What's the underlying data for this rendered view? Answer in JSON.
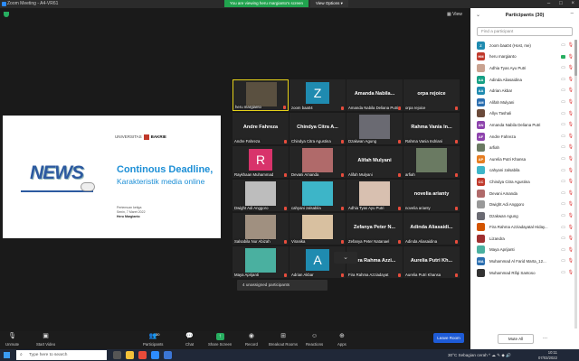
{
  "window": {
    "title": "Zoom Meeting - A4-VR61"
  },
  "viewbar": {
    "message": "You are viewing heru margianto's screen",
    "options_label": "View Options ▾"
  },
  "view_label": "▦ View",
  "slide": {
    "university": "UNIVERSITAS",
    "brand": "BAKRIE",
    "news": "NEWS",
    "title": "Continous Deadline,",
    "subtitle": "Karakteristik media online",
    "meta1": "Pertemuan ketiga",
    "meta2": "Senin, 7 Maret 2022",
    "meta3": "Heru Margianto"
  },
  "tiles": [
    {
      "name": "heru margianto",
      "kind": "photo",
      "color": "#5a5040",
      "active": true
    },
    {
      "name": "zoom baa04",
      "kind": "letter",
      "letter": "Z",
      "color": "#1f8bb0"
    },
    {
      "name": "Amanda Nabila Deliana Putri",
      "big": "Amanda Nabila...",
      "kind": "name"
    },
    {
      "name": "orpa rejoice",
      "big": "orpa rejoice",
      "kind": "name"
    },
    {
      "name": "Andre Fahreza",
      "big": "Andre Fahreza",
      "kind": "name"
    },
    {
      "name": "Chindya Citra Agustina",
      "big": "Chindya Citra A...",
      "kind": "name"
    },
    {
      "name": "Dzakwan Agung",
      "kind": "photo",
      "color": "#6a6a72"
    },
    {
      "name": "Rahma Vania Indriani",
      "big": "Rahma Vania In...",
      "kind": "name"
    },
    {
      "name": "Raykhaan Muhammad",
      "kind": "letter",
      "letter": "R",
      "color": "#d8336b"
    },
    {
      "name": "Devani Amanda",
      "kind": "photo",
      "color": "#b06a6a"
    },
    {
      "name": "Alifah Mulyani",
      "big": "Alifah Mulyani",
      "kind": "name"
    },
    {
      "name": "arfiah",
      "kind": "photo",
      "color": "#6a7a62"
    },
    {
      "name": "Dwight Adi Anggoro",
      "kind": "photo",
      "color": "#bdbdbd"
    },
    {
      "name": "cahyani zalsabila",
      "kind": "photo",
      "color": "#3db5c8"
    },
    {
      "name": "Adhia Tyas Ayu Putri",
      "kind": "photo",
      "color": "#d8c0b0"
    },
    {
      "name": "novelia arianty",
      "big": "novelia arianty",
      "kind": "name"
    },
    {
      "name": "Salsabila Nur Abizah",
      "kind": "photo",
      "color": "#a09080"
    },
    {
      "name": "Viranika",
      "kind": "photo",
      "color": "#d8c0a0"
    },
    {
      "name": "Zefanya Peter Natanael",
      "big": "Zefanya Peter N...",
      "kind": "name"
    },
    {
      "name": "Adinda Aliasaidina",
      "big": "Adinda Aliasaidi...",
      "kind": "name"
    },
    {
      "name": "Maya Aprijanti",
      "kind": "photo",
      "color": "#4ab0a0"
    },
    {
      "name": "Adrian Akbar",
      "kind": "letter",
      "letter": "A",
      "color": "#1f8bb0"
    },
    {
      "name": "Fira Rahma Azziadayat",
      "big": "Fira Rahma Azzi...",
      "kind": "name"
    },
    {
      "name": "Aurelia Putri Khansa",
      "big": "Aurelia Putri Kh...",
      "kind": "name"
    }
  ],
  "unassigned": "4 unassigned participants",
  "toolbar": {
    "unmute": "Unmute",
    "start_video": "Start Video",
    "participants": "Participants",
    "participants_count": "30",
    "chat": "Chat",
    "share": "Share Screen",
    "record": "Record",
    "breakout": "Breakout Rooms",
    "reactions": "Reactions",
    "apps": "Apps",
    "leave": "Leave Room"
  },
  "panel": {
    "title": "Participants (30)",
    "search_placeholder": "Find a participant",
    "mute_all": "Mute All",
    "more": "..."
  },
  "participants": [
    {
      "initials": "Z",
      "name": "zoom baa04 (Host, me)",
      "color": "#1f8bb0",
      "video": false
    },
    {
      "initials": "HM",
      "name": "heru margianto",
      "color": "#c0392b",
      "video": true
    },
    {
      "initials": "",
      "name": "Adhia Tyas Ayu Putri",
      "color": "#c9a290",
      "video": false
    },
    {
      "initials": "AA",
      "name": "Adinda Aliasaidina",
      "color": "#16a085",
      "video": false
    },
    {
      "initials": "AA",
      "name": "Adrian Akbar",
      "color": "#1f8bb0",
      "video": false
    },
    {
      "initials": "AM",
      "name": "Alifah Mulyani",
      "color": "#2c6fb0",
      "video": false
    },
    {
      "initials": "",
      "name": "Allyv Tashali",
      "color": "#6a4a3a",
      "video": false
    },
    {
      "initials": "AN",
      "name": "Amanda Nabila Deliana Putri",
      "color": "#8e44ad",
      "video": false
    },
    {
      "initials": "AF",
      "name": "Andre Fahreza",
      "color": "#8e44ad",
      "video": false
    },
    {
      "initials": "",
      "name": "arfiah",
      "color": "#6a7a62",
      "video": false
    },
    {
      "initials": "AP",
      "name": "Aurelia Putri Khansa",
      "color": "#e67e22",
      "video": false
    },
    {
      "initials": "",
      "name": "cahyani zalsabila",
      "color": "#3db5c8",
      "video": false
    },
    {
      "initials": "CC",
      "name": "Chindya Citra Agustina",
      "color": "#c0392b",
      "video": false
    },
    {
      "initials": "",
      "name": "Devani Amanda",
      "color": "#b06a6a",
      "video": false
    },
    {
      "initials": "",
      "name": "Dwight Adi Anggoro",
      "color": "#999999",
      "video": false
    },
    {
      "initials": "",
      "name": "Dzakwan Agung",
      "color": "#6a6a72",
      "video": false
    },
    {
      "initials": "",
      "name": "Fira Rahma Azziadayatal Hiday...",
      "color": "#d35400",
      "video": false
    },
    {
      "initials": "",
      "name": "Lizandra",
      "color": "#a03030",
      "video": false
    },
    {
      "initials": "",
      "name": "Maya Aprijanti",
      "color": "#4ab0a0",
      "video": false
    },
    {
      "initials": "MA",
      "name": "Muhammad Al Farid Marta_12...",
      "color": "#2c6fb0",
      "video": false
    },
    {
      "initials": "",
      "name": "Muhammad Rifqi Santoso",
      "color": "#333333",
      "video": false
    }
  ],
  "taskbar": {
    "search": "Type here to search",
    "weather": "30°C  Sebagian cerah  ^ ☁ ✎ ◆ 🔊",
    "time": "10:11",
    "date": "07/03/2022"
  }
}
